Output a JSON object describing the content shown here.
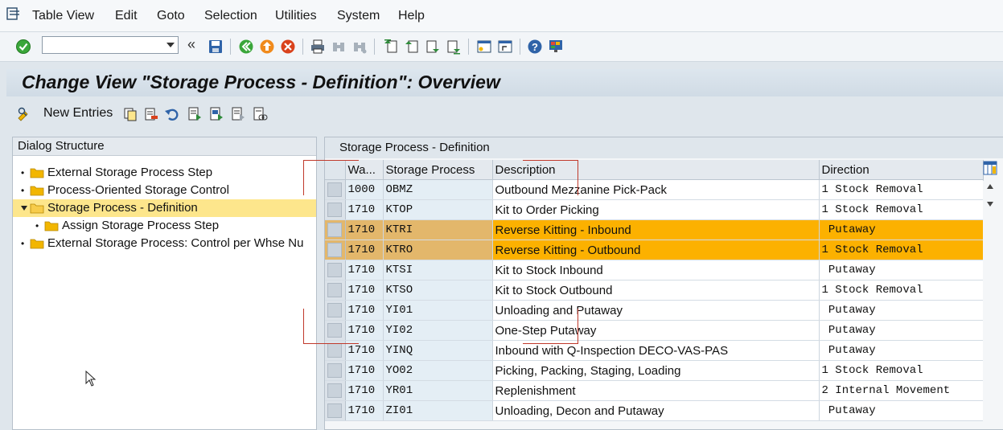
{
  "menubar": {
    "items": [
      "Table View",
      "Edit",
      "Goto",
      "Selection",
      "Utilities",
      "System",
      "Help"
    ]
  },
  "toolbar": {
    "command_value": "",
    "back_glyph": "«"
  },
  "title": "Change View \"Storage Process - Definition\": Overview",
  "app_toolbar": {
    "new_entries_label": "New Entries"
  },
  "dialog_structure": {
    "header": "Dialog Structure",
    "nodes": [
      {
        "label": "External Storage Process Step",
        "level": 0,
        "selected": false,
        "expanded": false
      },
      {
        "label": "Process-Oriented Storage Control",
        "level": 0,
        "selected": false,
        "expanded": false
      },
      {
        "label": "Storage Process - Definition",
        "level": 0,
        "selected": true,
        "expanded": true
      },
      {
        "label": "Assign Storage Process Step",
        "level": 1,
        "selected": false,
        "expanded": false
      },
      {
        "label": "External Storage Process: Control per Whse Nu",
        "level": 0,
        "selected": false,
        "expanded": false
      }
    ]
  },
  "table": {
    "panel_title": "Storage Process - Definition",
    "columns": [
      "Wa...",
      "Storage Process",
      "Description",
      "Direction"
    ],
    "rows": [
      {
        "warehouse": "1000",
        "process": "OBMZ",
        "description": "Outbound Mezzanine Pick-Pack",
        "direction": "1 Stock Removal",
        "highlighted": false
      },
      {
        "warehouse": "1710",
        "process": "KTOP",
        "description": "Kit to Order Picking",
        "direction": "1 Stock Removal",
        "highlighted": false
      },
      {
        "warehouse": "1710",
        "process": "KTRI",
        "description": "Reverse Kitting - Inbound",
        "direction": " Putaway",
        "highlighted": true
      },
      {
        "warehouse": "1710",
        "process": "KTRO",
        "description": "Reverse Kitting - Outbound",
        "direction": "1 Stock Removal",
        "highlighted": true
      },
      {
        "warehouse": "1710",
        "process": "KTSI",
        "description": "Kit to Stock Inbound",
        "direction": " Putaway",
        "highlighted": false
      },
      {
        "warehouse": "1710",
        "process": "KTSO",
        "description": "Kit to Stock Outbound",
        "direction": "1 Stock Removal",
        "highlighted": false
      },
      {
        "warehouse": "1710",
        "process": "YI01",
        "description": "Unloading and Putaway",
        "direction": " Putaway",
        "highlighted": false
      },
      {
        "warehouse": "1710",
        "process": "YI02",
        "description": "One-Step Putaway",
        "direction": " Putaway",
        "highlighted": false
      },
      {
        "warehouse": "1710",
        "process": "YINQ",
        "description": "Inbound with Q-Inspection DECO-VAS-PAS",
        "direction": " Putaway",
        "highlighted": false
      },
      {
        "warehouse": "1710",
        "process": "YO02",
        "description": "Picking, Packing, Staging, Loading",
        "direction": "1 Stock Removal",
        "highlighted": false
      },
      {
        "warehouse": "1710",
        "process": "YR01",
        "description": "Replenishment",
        "direction": "2 Internal Movement",
        "highlighted": false
      },
      {
        "warehouse": "1710",
        "process": "ZI01",
        "description": "Unloading, Decon  and Putaway",
        "direction": " Putaway",
        "highlighted": false
      }
    ]
  },
  "colors": {
    "highlight_row": "#fcb100",
    "highlight_key": "#e3b76b",
    "selected_tree_node": "#fde68c",
    "annotation": "#c0392b"
  },
  "icons": {
    "menu": "menu-list-icon",
    "enter": "green-check-icon",
    "save": "save-icon",
    "back": "back-icon",
    "exit": "exit-icon",
    "cancel": "cancel-icon",
    "print": "print-icon",
    "find": "find-icon",
    "find_next": "find-next-icon",
    "first_page": "first-page-icon",
    "prev_page": "previous-page-icon",
    "next_page": "next-page-icon",
    "last_page": "last-page-icon",
    "new_session": "new-session-icon",
    "shortcut": "shortcut-icon",
    "help": "help-icon",
    "customize": "customize-layout-icon",
    "column_settings": "column-settings-icon"
  }
}
